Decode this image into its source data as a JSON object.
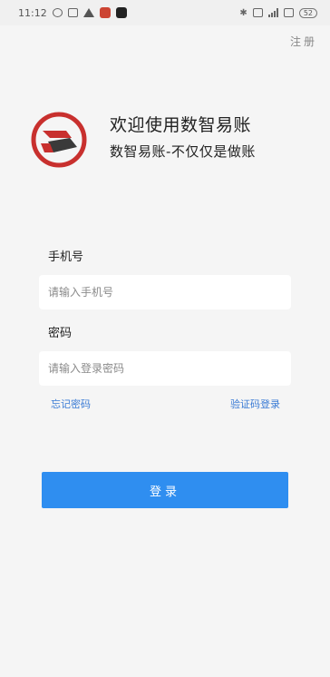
{
  "status_bar": {
    "time": "11:12",
    "battery": "52"
  },
  "header": {
    "register": "注册"
  },
  "welcome": {
    "title": "欢迎使用数智易账",
    "subtitle": "数智易账-不仅仅是做账"
  },
  "form": {
    "phone": {
      "label": "手机号",
      "placeholder": "请输入手机号",
      "value": ""
    },
    "password": {
      "label": "密码",
      "placeholder": "请输入登录密码",
      "value": ""
    },
    "forgot_password": "忘记密码",
    "sms_login": "验证码登录",
    "submit": "登录"
  },
  "colors": {
    "accent": "#2f8ef0",
    "link": "#3a7bd5",
    "logo_red": "#c8302e",
    "logo_dark": "#3a3a3a"
  }
}
